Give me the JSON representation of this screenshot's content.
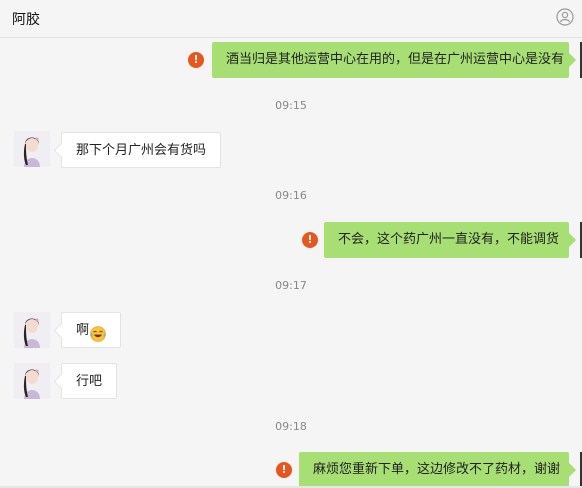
{
  "header": {
    "title": "阿胶"
  },
  "messages": [
    {
      "text": "酒当归是其他运营中心在用的，但是在广州运营中心是没有"
    },
    {
      "time": "09:15"
    },
    {
      "text": "那下个月广州会有货吗"
    },
    {
      "time": "09:16"
    },
    {
      "text": "不会，这个药广州一直没有，不能调货"
    },
    {
      "time": "09:17"
    },
    {
      "text": "啊"
    },
    {
      "text": "行吧"
    },
    {
      "time": "09:18"
    },
    {
      "text": "麻烦您重新下单，这边修改不了药材，谢谢"
    }
  ],
  "icons": {
    "error": "!",
    "error_color": "#e8561e",
    "outgoing_bubble_color": "#a7df75",
    "incoming_bubble_color": "#ffffff",
    "emoji": "laughing-tears-emoji-icon",
    "profile": "profile-icon"
  }
}
